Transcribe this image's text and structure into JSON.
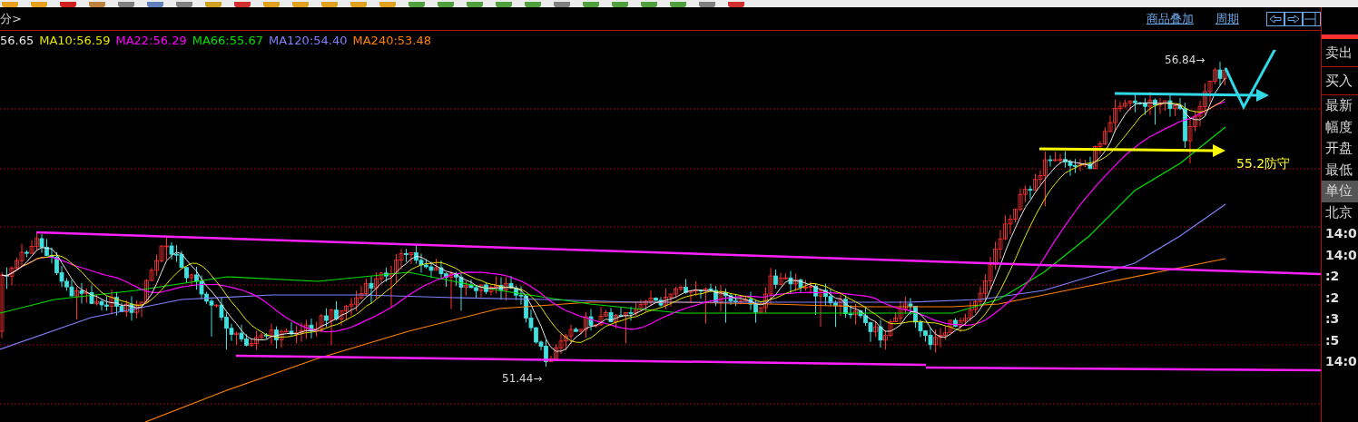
{
  "header": {
    "period_label": "分>",
    "links": [
      "商品叠加",
      "周期"
    ]
  },
  "legend": [
    {
      "text": "56.65",
      "color": "#e8e8e8"
    },
    {
      "text": "MA10:56.59",
      "color": "#e6e600"
    },
    {
      "text": "MA22:56.29",
      "color": "#ff00ff"
    },
    {
      "text": "MA66:55.67",
      "color": "#00e000"
    },
    {
      "text": "MA120:54.40",
      "color": "#8080ff"
    },
    {
      "text": "MA240:53.48",
      "color": "#ff8000"
    }
  ],
  "chart": {
    "high_label": "56.84→",
    "low_label": "51.44→",
    "support_label": "55.2防守"
  },
  "side_panel": [
    {
      "label": "卖出",
      "selected": false
    },
    {
      "label": "买入",
      "selected": false
    },
    {
      "label": "最新",
      "selected": false
    },
    {
      "label": "幅度",
      "selected": false
    },
    {
      "label": "开盘",
      "selected": false
    },
    {
      "label": "最低",
      "selected": false
    },
    {
      "label": "单位",
      "selected": true
    },
    {
      "label": "北京",
      "selected": false
    },
    {
      "label": "14:0",
      "selected": false
    },
    {
      "label": "14:0",
      "selected": false
    },
    {
      "label": ":2",
      "selected": false
    },
    {
      "label": ":2",
      "selected": false
    },
    {
      "label": ":3",
      "selected": false
    },
    {
      "label": ":5",
      "selected": false
    },
    {
      "label": "14:0",
      "selected": false
    }
  ]
}
